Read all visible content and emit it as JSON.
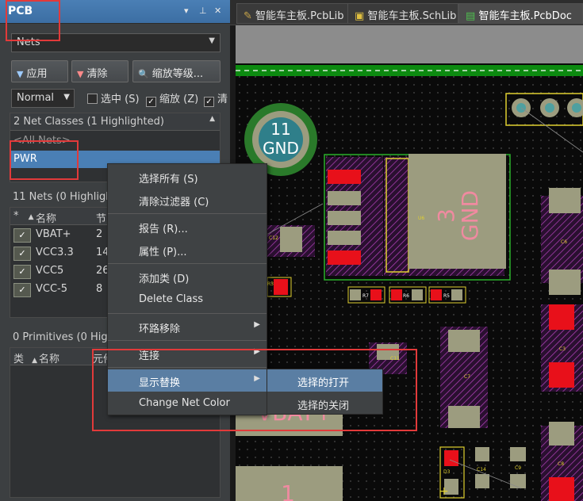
{
  "panel": {
    "title": "PCB",
    "controls": [
      "▾",
      "⊥",
      "✕"
    ],
    "mode_combo": "Nets",
    "buttons": {
      "apply": "应用",
      "clear": "清除",
      "zoom_level": "缩放等级..."
    },
    "view_mode": "Normal",
    "checkboxes": [
      {
        "label": "选中 (S)",
        "checked": false
      },
      {
        "label": "缩放 (Z)",
        "checked": true
      },
      {
        "label": "清",
        "checked": true
      }
    ],
    "classes_header": "2 Net Classes (1 Highlighted)",
    "classes": [
      "<All Nets>",
      "PWR"
    ],
    "nets_header": "11 Nets (0 Highligh",
    "net_columns": [
      "*",
      "名称",
      "节"
    ],
    "nets": [
      {
        "name": "VBAT+",
        "count": "2"
      },
      {
        "name": "VCC3.3",
        "count": "14"
      },
      {
        "name": "VCC5",
        "count": "26"
      },
      {
        "name": "VCC-5",
        "count": "8"
      }
    ],
    "primitives_header": "0 Primitives (0 High",
    "prim_columns": [
      "类",
      "名称",
      "元件"
    ]
  },
  "tabs": [
    {
      "label": "智能车主板.PcbLib",
      "icon": "pcblib-icon"
    },
    {
      "label": "智能车主板.SchLib",
      "icon": "schlib-icon"
    },
    {
      "label": "智能车主板.PcbDoc",
      "icon": "pcbdoc-icon",
      "active": true
    }
  ],
  "context_menu": {
    "items": [
      {
        "label": "选择所有 (S)"
      },
      {
        "label": "清除过滤器 (C)"
      },
      {
        "label": "报告 (R)..."
      },
      {
        "label": "属性 (P)..."
      },
      {
        "label": "添加类 (D)"
      },
      {
        "label": "Delete Class"
      },
      {
        "label": "环路移除",
        "submenu": true
      },
      {
        "label": "连接",
        "submenu": true
      },
      {
        "label": "显示替换",
        "submenu": true,
        "highlighted": true
      },
      {
        "label": "Change Net Color"
      }
    ],
    "submenu": [
      "选择的打开",
      "选择的关闭"
    ]
  },
  "board": {
    "gnd_via": {
      "num": "11",
      "net": "GND"
    },
    "big_pad": {
      "num": "3",
      "net": "GND"
    },
    "vbat_label": "VBAT+",
    "bottom_label": "1",
    "refs": [
      "U6",
      "C12",
      "R7",
      "R6",
      "R5",
      "C11",
      "C7",
      "C8",
      "C3",
      "C6",
      "D3",
      "C14",
      "C9",
      "R3"
    ]
  },
  "colors": {
    "accent": "#4a7fb5",
    "highlight_box": "#e23a3a",
    "pad": "#9c9c7f",
    "pad_red": "#e8101a"
  }
}
